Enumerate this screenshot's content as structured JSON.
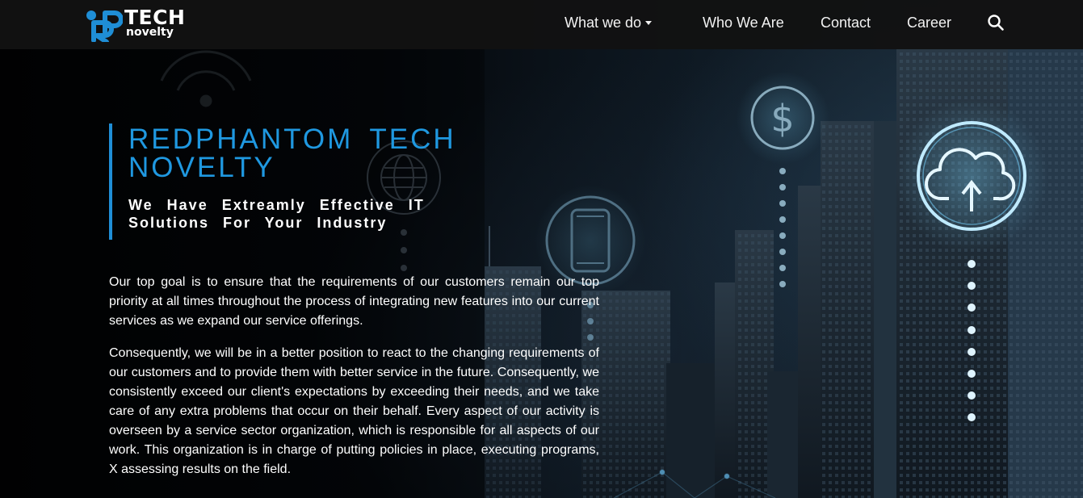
{
  "brand": {
    "logo_top": "TECH",
    "logo_bottom": "novelty",
    "logo_mark": "RP",
    "accent_color": "#1f8ed6"
  },
  "nav": {
    "items": [
      {
        "label": "What we do",
        "has_dropdown": true
      },
      {
        "label": "Who We Are"
      },
      {
        "label": "Contact"
      },
      {
        "label": "Career"
      }
    ],
    "search_icon": "search-icon"
  },
  "hero": {
    "title": "REDPHANTOM TECH NOVELTY",
    "subtitle": "We Have Extreamly Effective IT Solutions For Your Industry",
    "paragraphs": [
      "Our top goal is to ensure that the requirements of our customers remain our top priority at all times throughout the process of integrating new features into our current services as we expand our service offerings.",
      "Consequently, we will be in a better position to react to the changing requirements of our customers and to provide them with better service in the future. Consequently, we consistently exceed our client's expectations by exceeding their needs, and we take care of any extra problems that occur on their behalf. Every aspect of our activity is overseen by a service sector organization, which is responsible for all aspects of our work. This organization is in charge of putting policies in place, executing programs, X assessing results on the field."
    ]
  },
  "background": {
    "icons": [
      "wifi-icon",
      "globe-icon",
      "smartphone-icon",
      "dollar-icon",
      "cloud-upload-icon"
    ],
    "dollar_symbol": "$"
  }
}
